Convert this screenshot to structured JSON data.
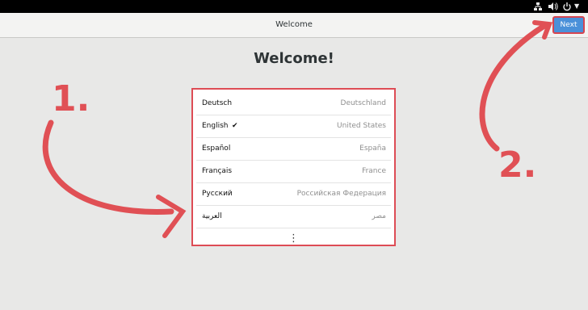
{
  "window": {
    "title": "Welcome"
  },
  "header": {
    "next_label": "Next"
  },
  "main": {
    "heading": "Welcome!"
  },
  "tray": {
    "network_icon": "network-icon",
    "volume_icon": "volume-icon",
    "power_icon": "power-icon",
    "menu_icon": "chevron-down-icon"
  },
  "languages": [
    {
      "name": "Deutsch",
      "region": "Deutschland"
    },
    {
      "name": "English",
      "region": "United States",
      "selected": true
    },
    {
      "name": "Español",
      "region": "España"
    },
    {
      "name": "Français",
      "region": "France"
    },
    {
      "name": "Русский",
      "region": "Российская Федерация"
    },
    {
      "name": "العربية",
      "region": "مصر"
    }
  ],
  "more": {
    "icon": "more-vertical-icon"
  },
  "annotations": {
    "step1": "1.",
    "step2": "2.",
    "color": "#e05055"
  },
  "colors": {
    "accent": "#4a90d9",
    "highlight": "#dd4c55"
  }
}
